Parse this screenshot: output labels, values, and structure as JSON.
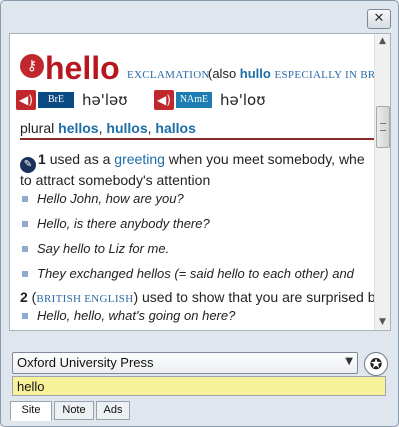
{
  "window": {
    "close_label": "✕"
  },
  "entry": {
    "headword": "hello",
    "key_icon": "key-icon",
    "part_of_speech": "EXCLAMATION",
    "also_prefix": "(also ",
    "also_word": "hullo",
    "also_region": "ESPECIALLY IN BR",
    "pronunciations": [
      {
        "variant": "BrE",
        "ipa": "hə'ləʊ"
      },
      {
        "variant": "NAmE",
        "ipa": "hə'loʊ"
      }
    ],
    "plural_label": "plural",
    "plurals": [
      "hellos",
      "hullos",
      "hallos"
    ],
    "sense1": {
      "number": "1",
      "text_before": "used as a",
      "link": "greeting",
      "text_after": "when you meet somebody, whe",
      "line2": "to attract somebody's attention"
    },
    "examples1": [
      "Hello John, how are you?",
      "Hello, is there anybody there?",
      "Say hello to Liz for me.",
      "They exchanged hellos (= said hello to each other) and"
    ],
    "sense2": {
      "number": "2",
      "region": "BRITISH ENGLISH",
      "text": "used to show that you are surprised b"
    },
    "examples2": [
      "Hello, hello, what's going on here?"
    ]
  },
  "source": {
    "selected": "Oxford University Press"
  },
  "search": {
    "value": "hello"
  },
  "tabs": [
    {
      "label": "Site"
    },
    {
      "label": "Note"
    },
    {
      "label": "Ads"
    }
  ],
  "colors": {
    "headword": "#b8171f",
    "link": "#1c6da8",
    "search_bg": "#f7f199"
  }
}
